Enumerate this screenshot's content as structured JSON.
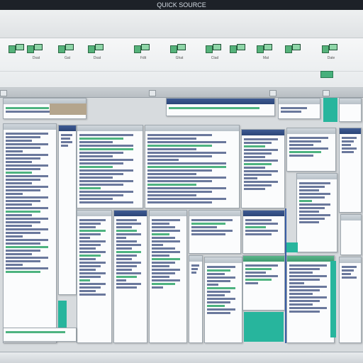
{
  "window": {
    "title": "QUICK SOURCE"
  },
  "toolbar_top": {
    "right_label": "—"
  },
  "ribbon": {
    "buttons": [
      {
        "label": ""
      },
      {
        "label": "Dsat"
      },
      {
        "label": "Gat"
      },
      {
        "label": "Dsat"
      },
      {
        "label": "Fdit"
      },
      {
        "label": "Ghat"
      },
      {
        "label": "Ctad"
      },
      {
        "label": ""
      },
      {
        "label": "Mat"
      },
      {
        "label": ""
      },
      {
        "label": "Date"
      }
    ]
  },
  "sheet": {
    "tabs": [
      "",
      "",
      "",
      ""
    ]
  },
  "colors": {
    "accent_green": "#2fa66a",
    "accent_teal": "#27b59d",
    "accent_blue": "#3a5ea6",
    "titlebar": "#1d2128"
  }
}
